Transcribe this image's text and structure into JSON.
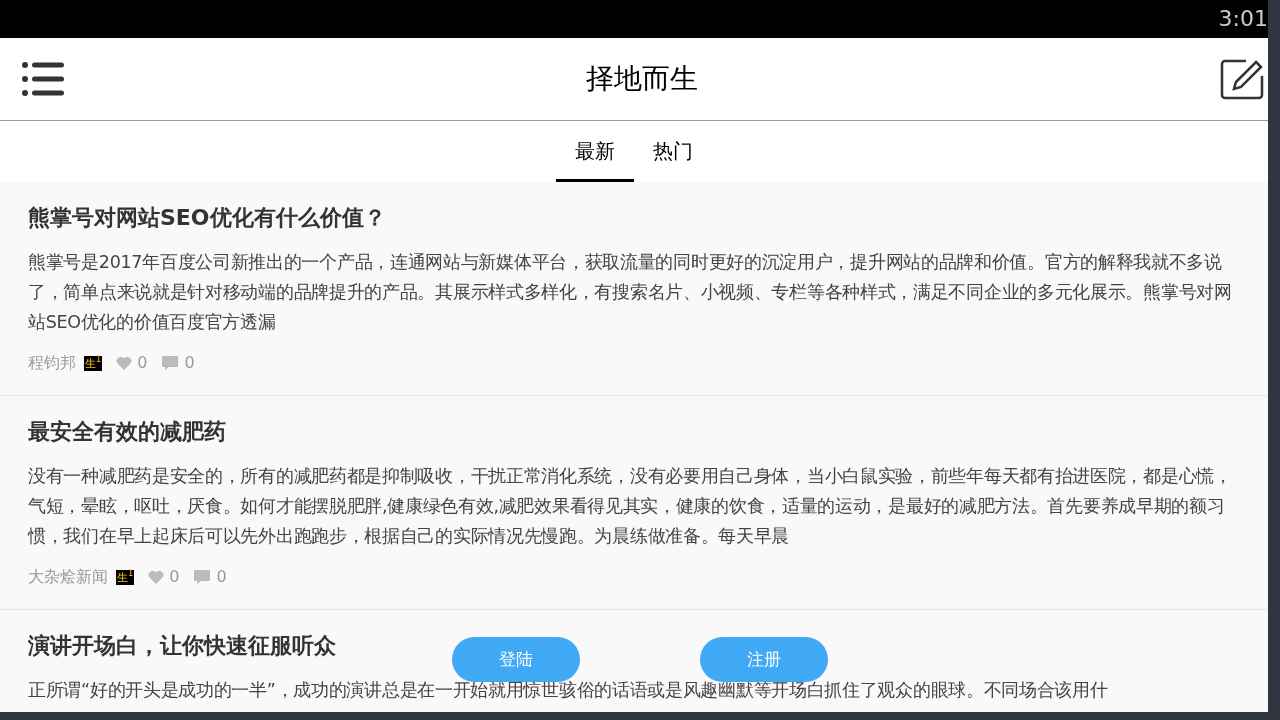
{
  "status_bar": {
    "time": "3:01"
  },
  "header": {
    "title": "择地而生"
  },
  "tabs": [
    {
      "label": "最新",
      "selected": true
    },
    {
      "label": "热门",
      "selected": false
    }
  ],
  "posts": [
    {
      "title": "熊掌号对网站SEO优化有什么价值？",
      "body": "熊掌号是2017年百度公司新推出的一个产品，连通网站与新媒体平台，获取流量的同时更好的沉淀用户，提升网站的品牌和价值。官方的解释我就不多说了，简单点来说就是针对移动端的品牌提升的产品。其展示样式多样化，有搜索名片、小视频、专栏等各种样式，满足不同企业的多元化展示。熊掌号对网站SEO优化的价值百度官方透漏",
      "author": "程钧邦",
      "badge": "生$^{1}$",
      "likes": "0",
      "comments": "0"
    },
    {
      "title": "最安全有效的减肥药",
      "body": "没有一种减肥药是安全的，所有的减肥药都是抑制吸收，干扰正常消化系统，没有必要用自己身体，当小白鼠实验，前些年每天都有抬进医院，都是心慌，气短，晕眩，呕吐，厌食。如何才能摆脱肥胖,健康绿色有效,减肥效果看得见其实，健康的饮食，适量的运动，是最好的减肥方法。首先要养成早期的额习惯，我们在早上起床后可以先外出跑跑步，根据自己的实际情况先慢跑。为晨练做准备。每天早晨",
      "author": "大杂烩新闻",
      "badge": "生$^{1}$",
      "likes": "0",
      "comments": "0"
    },
    {
      "title": "演讲开场白，让你快速征服听众",
      "body": "正所谓“好的开头是成功的一半”，成功的演讲总是在一开始就用惊世骇俗的话语或是风趣幽默等开场白抓住了观众的眼球。不同场合该用什"
    }
  ],
  "buttons": [
    {
      "label": "登陆"
    },
    {
      "label": "注册"
    }
  ]
}
